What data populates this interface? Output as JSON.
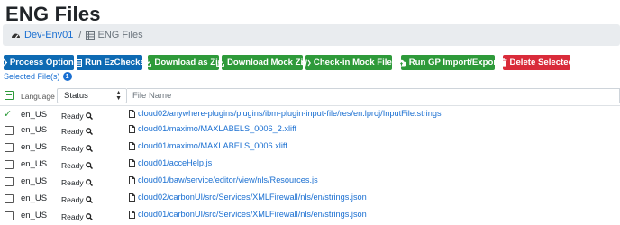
{
  "page": {
    "title": "ENG Files"
  },
  "breadcrumb": {
    "env": "Dev-Env01",
    "separator": "/",
    "current": "ENG Files"
  },
  "toolbar": {
    "process_options": "Process Options",
    "run_ezchecks": "Run EzChecks",
    "download_zip": "Download as Zip",
    "download_mock_zip": "Download Mock Zip",
    "checkin_mock": "Check-in Mock Files",
    "run_gp": "Run GP Import/Export",
    "delete_selected": "Delete Selected"
  },
  "selection": {
    "label": "Selected File(s)",
    "count": "1"
  },
  "table": {
    "headers": {
      "language": "Language",
      "status": "Status",
      "filename_placeholder": "File Name"
    },
    "rows": [
      {
        "language": "en_US",
        "status": "Ready",
        "file": "cloud02/anywhere-plugins/plugins/ibm-plugin-input-file/res/en.lproj/InputFile.strings",
        "checked": true
      },
      {
        "language": "en_US",
        "status": "Ready",
        "file": "cloud01/maximo/MAXLABELS_0006_2.xliff",
        "checked": false
      },
      {
        "language": "en_US",
        "status": "Ready",
        "file": "cloud01/maximo/MAXLABELS_0006.xliff",
        "checked": false
      },
      {
        "language": "en_US",
        "status": "Ready",
        "file": "cloud01/acceHelp.js",
        "checked": false
      },
      {
        "language": "en_US",
        "status": "Ready",
        "file": "cloud01/baw/service/editor/view/nls/Resources.js",
        "checked": false
      },
      {
        "language": "en_US",
        "status": "Ready",
        "file": "cloud02/carbonUI/src/Services/XMLFirewall/nls/en/strings.json",
        "checked": false
      },
      {
        "language": "en_US",
        "status": "Ready",
        "file": "cloud01/carbonUI/src/Services/XMLFirewall/nls/en/strings.json",
        "checked": false
      }
    ]
  },
  "colors": {
    "primary": "#0d6ab3",
    "success": "#2e9a3a",
    "danger": "#d92b3a",
    "link": "#1a6fd1"
  }
}
